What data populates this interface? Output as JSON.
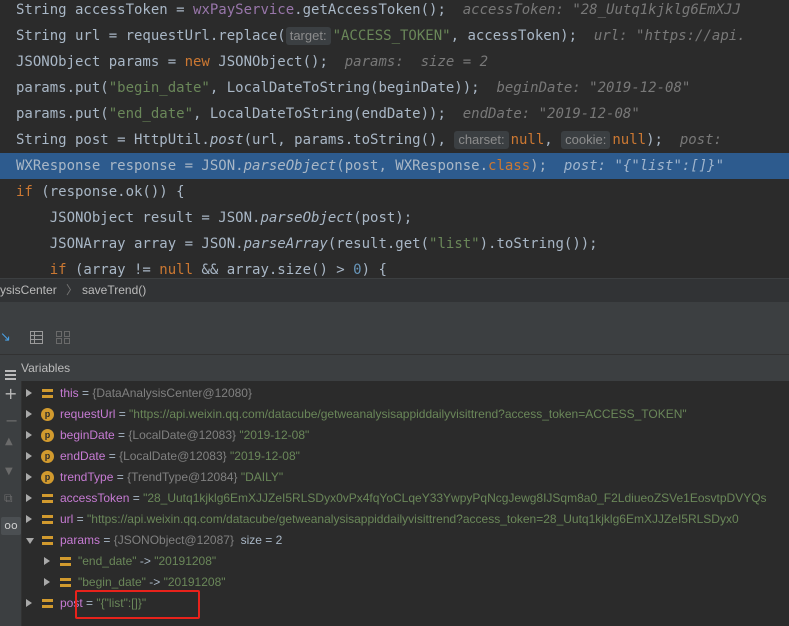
{
  "editor": {
    "lines": [
      {
        "code_a": "String accessToken = ",
        "code_b": "wxPayService",
        "code_c": ".getAccessToken();",
        "hint": "accessToken: \"28_Uutq1kjklg6EmXJJ"
      },
      {
        "code_a": "String url = requestUrl.replace(",
        "inlay": "target:",
        "code_b": "\"ACCESS_TOKEN\"",
        "code_c": ", accessToken);",
        "hint": "url: \"https://api."
      },
      {
        "code_a": "JSONObject params = ",
        "kw": "new",
        "code_c": " JSONObject();",
        "hint": "params:  size = 2"
      },
      {
        "code_a": "params.put(",
        "code_b": "\"begin_date\"",
        "code_c": ", LocalDateToString(beginDate));",
        "hint": "beginDate: \"2019-12-08\""
      },
      {
        "code_a": "params.put(",
        "code_b": "\"end_date\"",
        "code_c": ", LocalDateToString(endDate));",
        "hint": "endDate: \"2019-12-08\""
      },
      {
        "code_a": "String post = HttpUtil.",
        "method": "post",
        "code_c": "(url, params.toString(),",
        "inlay1": "charset:",
        "null1": "null",
        "comma": ",",
        "inlay2": "cookie:",
        "null2": "null",
        "code_d": ");",
        "hint": "post:"
      },
      {
        "code_a": "WXResponse response = JSON.",
        "method": "parseObject",
        "code_c": "(post, WXResponse.",
        "kw": "class",
        "code_d": ");",
        "hint": "post: \"{\"list\":[]}\""
      },
      {
        "kw": "if",
        "code_a": " (response.ok()) {"
      },
      {
        "code_a": "    JSONObject result = JSON.",
        "method": "parseObject",
        "code_c": "(post);"
      },
      {
        "code_a": "    JSONArray array = JSON.",
        "method": "parseArray",
        "code_c": "(result.get(",
        "str": "\"list\"",
        "code_d": ").toString());"
      },
      {
        "kw1": "if",
        "code_a": " (array != ",
        "kw2": "null",
        "code_c": " && array.size() > ",
        "num": "0",
        "code_d": ") {"
      }
    ]
  },
  "breadcrumb": {
    "class_name": "ysisCenter",
    "separator": "〉",
    "method_name": "saveTrend()"
  },
  "panel": {
    "title": "Variables"
  },
  "variables": [
    {
      "icon": "field",
      "name": "this",
      "eq": " = ",
      "type": "{DataAnalysisCenter@12080}",
      "value": "",
      "expanded": false,
      "indent": 0
    },
    {
      "icon": "p",
      "name": "requestUrl",
      "eq": " = ",
      "type": "",
      "value": "\"https://api.weixin.qq.com/datacube/getweanalysisappiddailyvisittrend?access_token=ACCESS_TOKEN\"",
      "expanded": false,
      "indent": 0
    },
    {
      "icon": "p",
      "name": "beginDate",
      "eq": " = ",
      "type": "{LocalDate@12083}",
      "value": " \"2019-12-08\"",
      "expanded": false,
      "indent": 0
    },
    {
      "icon": "p",
      "name": "endDate",
      "eq": " = ",
      "type": "{LocalDate@12083}",
      "value": " \"2019-12-08\"",
      "expanded": false,
      "indent": 0
    },
    {
      "icon": "p",
      "name": "trendType",
      "eq": " = ",
      "type": "{TrendType@12084}",
      "value": " \"DAILY\"",
      "expanded": false,
      "indent": 0
    },
    {
      "icon": "field",
      "name": "accessToken",
      "eq": " = ",
      "type": "",
      "value": "\"28_Uutq1kjklg6EmXJJZeI5RLSDyx0vPx4fqYoCLqeY33YwpyPqNcgJewg8IJSqm8a0_F2LdiueoZSVe1EosvtpDVYQs",
      "expanded": false,
      "indent": 0
    },
    {
      "icon": "field",
      "name": "url",
      "eq": " = ",
      "type": "",
      "value": "\"https://api.weixin.qq.com/datacube/getweanalysisappiddailyvisittrend?access_token=28_Uutq1kjklg6EmXJJZeI5RLSDyx0",
      "expanded": false,
      "indent": 0
    },
    {
      "icon": "field",
      "name": "params",
      "eq": " = ",
      "type": "{JSONObject@12087}",
      "value": "  size = 2",
      "expanded": true,
      "indent": 0
    },
    {
      "icon": "field",
      "name": "\"end_date\"",
      "eq": " -> ",
      "type": "",
      "value": "\"20191208\"",
      "expanded": false,
      "indent": 1
    },
    {
      "icon": "field",
      "name": "\"begin_date\"",
      "eq": " -> ",
      "type": "",
      "value": "\"20191208\"",
      "expanded": false,
      "indent": 1
    },
    {
      "icon": "field",
      "name": "post",
      "eq": " = ",
      "type": "",
      "value": "\"{\"list\":[]}\"",
      "expanded": false,
      "indent": 0
    }
  ],
  "colors": {
    "highlight": "#2d5b8e",
    "annotation": "#e8221b"
  }
}
